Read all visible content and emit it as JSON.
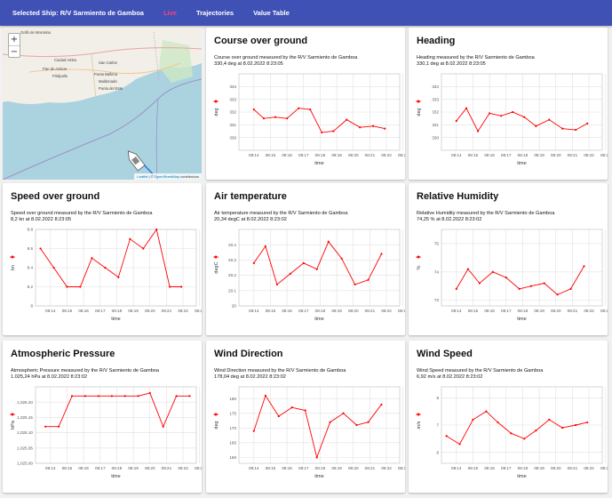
{
  "nav": {
    "selected_ship": "Selected Ship: R/V Sarmiento de Gamboa",
    "live": "Live",
    "trajectories": "Trajectories",
    "value_table": "Value Table"
  },
  "colors": {
    "bar": "#3f51b5",
    "active": "#ff4081",
    "series": "#ff0000"
  },
  "map": {
    "zoom_in": "+",
    "zoom_out": "−",
    "attribution_leaflet": "Leaflet",
    "attribution_sep": " | © ",
    "attribution_osm": "OpenStreetMap",
    "attribution_rest": " contributors",
    "labels": [
      "Golfo de Morosino",
      "Ciudad Arista",
      "San Carlos",
      "Pan de Azúcar",
      "Piriápolis",
      "Punta Ballena",
      "Maldonado",
      "Punta del Este"
    ]
  },
  "x_ticks": [
    "08:14",
    "08:15",
    "08:16",
    "08:17",
    "08:18",
    "08:19",
    "08:20",
    "08:21",
    "08:22",
    "08:23"
  ],
  "x_label": "time",
  "chart_data": [
    {
      "type": "line",
      "title": "Course over ground",
      "desc1": "Course over ground measured by the R/V Sarmiento de Gamboa",
      "desc2": "330,4 deg at 8.02.2022 8:23:05",
      "ylabel": "deg",
      "ylim": [
        329,
        335
      ],
      "yticks": [
        330,
        331,
        332,
        333,
        334
      ],
      "x": [
        0,
        0.6,
        1.3,
        2,
        2.7,
        3.4,
        4.1,
        4.8,
        5.6,
        6.4,
        7.2,
        7.9
      ],
      "y": [
        332.2,
        331.5,
        331.6,
        331.5,
        332.3,
        332.2,
        330.4,
        330.5,
        331.4,
        330.8,
        330.9,
        330.7
      ]
    },
    {
      "type": "line",
      "title": "Heading",
      "desc1": "Heading measured by the R/V Sarmiento de Gamboa",
      "desc2": "330,1 deg at 8.02.2022 8:23:05",
      "ylabel": "deg",
      "ylim": [
        329,
        335
      ],
      "yticks": [
        330,
        331,
        332,
        333,
        334
      ],
      "x": [
        0,
        0.6,
        1.3,
        2,
        2.7,
        3.4,
        4.1,
        4.8,
        5.6,
        6.4,
        7.2,
        7.9
      ],
      "y": [
        331.3,
        332.3,
        330.5,
        331.9,
        331.7,
        332,
        331.6,
        330.9,
        331.4,
        330.7,
        330.6,
        331.1
      ]
    },
    {
      "type": "line",
      "title": "Speed over ground",
      "desc1": "Speed over ground measured by the R/V Sarmiento de Gamboa",
      "desc2": "8,2 kn at 8.02.2022 8:23:05",
      "ylabel": "kn",
      "ylim": [
        8,
        8.8
      ],
      "yticks": [
        8,
        8.2,
        8.4,
        8.6,
        8.8
      ],
      "x": [
        -0.6,
        0.2,
        1,
        1.8,
        2.5,
        3.3,
        4.1,
        4.8,
        5.6,
        6.4,
        7.2,
        7.9
      ],
      "y": [
        8.6,
        8.4,
        8.2,
        8.2,
        8.5,
        8.4,
        8.3,
        8.7,
        8.6,
        8.8,
        8.2,
        8.2
      ]
    },
    {
      "type": "line",
      "title": "Air temperature",
      "desc1": "Air temperature measured by the R/V Sarmiento de Gamboa",
      "desc2": "20,34 degC at 8.02.2022 8:23:02",
      "ylabel": "degC",
      "ylim": [
        20,
        20.5
      ],
      "yticks": [
        20,
        20.1,
        20.2,
        20.3,
        20.4
      ],
      "x": [
        0,
        0.7,
        1.4,
        2.2,
        3,
        3.8,
        4.5,
        5.3,
        6.1,
        6.9,
        7.7
      ],
      "y": [
        20.28,
        20.39,
        20.14,
        20.21,
        20.28,
        20.24,
        20.42,
        20.31,
        20.14,
        20.17,
        20.34
      ]
    },
    {
      "type": "line",
      "title": "Relative Humidity",
      "desc1": "Relative Humidity measured by the R/V Sarmiento de Gamboa",
      "desc2": "74,25 % at 8.02.2022 8:23:02",
      "ylabel": "%",
      "ylim": [
        72.8,
        75.5
      ],
      "yticks": [
        73,
        74,
        75
      ],
      "x": [
        0,
        0.7,
        1.4,
        2.2,
        3,
        3.8,
        4.5,
        5.3,
        6.1,
        6.9,
        7.7
      ],
      "y": [
        73.4,
        74.1,
        73.6,
        74,
        73.8,
        73.4,
        73.5,
        73.6,
        73.2,
        73.4,
        74.2
      ]
    },
    {
      "type": "line",
      "title": "Atmospheric Pressure",
      "desc1": "Atmospheric Pressure measured by the R/V Sarmiento de Gamboa",
      "desc2": "1.025,24 hPa at 8.02.2022 8:23:02",
      "ylabel": "hPa",
      "ylim": [
        1025.0,
        1025.25
      ],
      "yticks": [
        1025.0,
        1025.05,
        1025.1,
        1025.15,
        1025.2
      ],
      "x": [
        -0.3,
        0.5,
        1.3,
        2.1,
        2.9,
        3.7,
        4.5,
        5.3,
        6,
        6.8,
        7.6,
        8.4
      ],
      "y": [
        1025.12,
        1025.12,
        1025.22,
        1025.22,
        1025.22,
        1025.22,
        1025.22,
        1025.22,
        1025.23,
        1025.12,
        1025.22,
        1025.22
      ]
    },
    {
      "type": "line",
      "title": "Wind Direction",
      "desc1": "Wind Direction measured by the R/V Sarmiento de Gamboa",
      "desc2": "178,04 deg at 8.02.2022 8:23:02",
      "ylabel": "deg",
      "ylim": [
        158,
        184
      ],
      "yticks": [
        160,
        165,
        170,
        175,
        180
      ],
      "x": [
        0,
        0.7,
        1.5,
        2.3,
        3.1,
        3.8,
        4.6,
        5.4,
        6.2,
        6.9,
        7.7
      ],
      "y": [
        169,
        181,
        174,
        177,
        176,
        160,
        172,
        175,
        171,
        172,
        178
      ]
    },
    {
      "type": "line",
      "title": "Wind Speed",
      "desc1": "Wind Speed measured by the R/V Sarmiento de Gamboa",
      "desc2": "6,92 m/s at 8.02.2022 8:23:02",
      "ylabel": "m/s",
      "ylim": [
        5.6,
        8.4
      ],
      "yticks": [
        6,
        7,
        8
      ],
      "x": [
        -0.6,
        0.2,
        1,
        1.8,
        2.5,
        3.3,
        4.1,
        4.8,
        5.6,
        6.4,
        7.2,
        7.9
      ],
      "y": [
        6.6,
        6.3,
        7.2,
        7.5,
        7.1,
        6.7,
        6.5,
        6.8,
        7.2,
        6.9,
        7,
        7.1
      ]
    }
  ]
}
